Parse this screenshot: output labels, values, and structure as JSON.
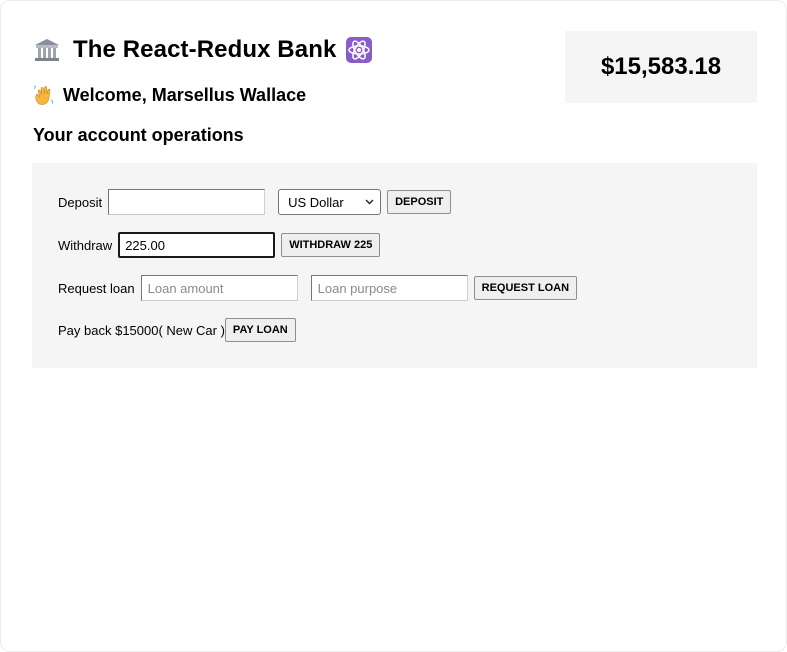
{
  "header": {
    "title": "The React-Redux Bank",
    "bank_icon": "bank-building-icon",
    "atom_icon": "atom-icon",
    "welcome_text": "Welcome, Marsellus Wallace",
    "wave_icon": "waving-hand-icon"
  },
  "balance": "$15,583.18",
  "section_title": "Your account operations",
  "deposit": {
    "label": "Deposit",
    "value": "",
    "currency_selected": "US Dollar",
    "button_label": "DEPOSIT"
  },
  "withdraw": {
    "label": "Withdraw",
    "value": "225.00",
    "button_label": "WITHDRAW 225"
  },
  "loan": {
    "label": "Request loan",
    "amount_placeholder": "Loan amount",
    "purpose_placeholder": "Loan purpose",
    "button_label": "REQUEST LOAN"
  },
  "payback": {
    "text": "Pay back $15000( New Car )",
    "button_label": "PAY LOAN"
  },
  "colors": {
    "panel_bg": "#f5f5f5",
    "atom_badge": "#8a5cc7"
  }
}
